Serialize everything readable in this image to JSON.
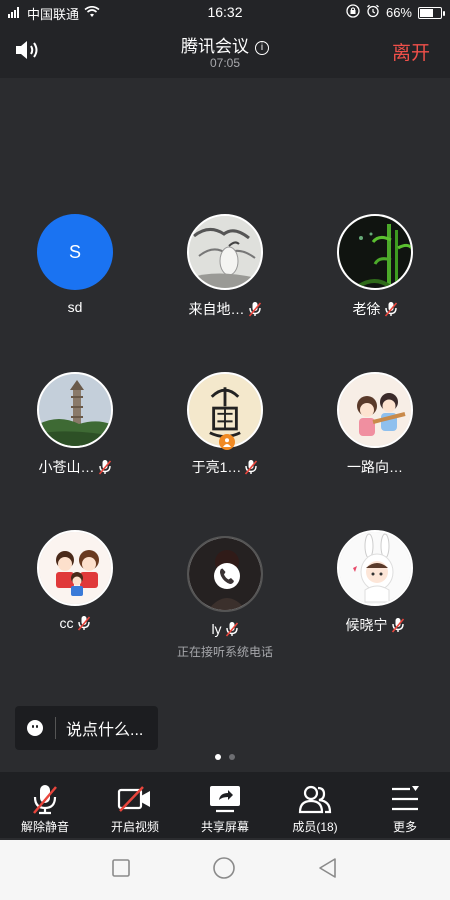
{
  "status_bar": {
    "carrier": "中国联通",
    "time": "16:32",
    "battery": "66%",
    "battery_level": 0.66
  },
  "header": {
    "title": "腾讯会议",
    "timer": "07:05",
    "leave_label": "离开"
  },
  "participants": [
    {
      "name": "sd",
      "initial": "S",
      "muted": false
    },
    {
      "name": "来自地…",
      "muted": true
    },
    {
      "name": "老徐",
      "muted": true
    },
    {
      "name": "小苍山…",
      "muted": true
    },
    {
      "name": "于亮1…",
      "muted": true
    },
    {
      "name": "一路向…",
      "muted": false
    },
    {
      "name": "cc",
      "muted": true
    },
    {
      "name": "ly",
      "muted": true,
      "note": "正在接听系统电话"
    },
    {
      "name": "候晓宁",
      "muted": true
    }
  ],
  "chat": {
    "placeholder": "说点什么..."
  },
  "toolbar": {
    "unmute": "解除静音",
    "start_video": "开启视频",
    "share_screen": "共享屏幕",
    "members": "成员(18)",
    "more": "更多"
  },
  "page_indicator": {
    "pages": 2,
    "current": 1
  },
  "colors": {
    "accent_blue": "#1a73f2",
    "leave_red": "#f0504a",
    "muted_red": "#e8453c"
  }
}
